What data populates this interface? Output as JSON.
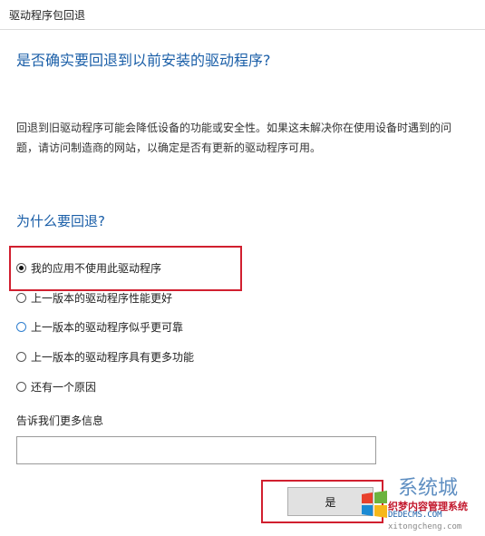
{
  "window": {
    "title": "驱动程序包回退"
  },
  "main_heading": "是否确实要回退到以前安装的驱动程序?",
  "description": "回退到旧驱动程序可能会降低设备的功能或安全性。如果这未解决你在使用设备时遇到的问题，请访问制造商的网站，以确定是否有更新的驱动程序可用。",
  "reasons": {
    "heading": "为什么要回退?",
    "options": [
      {
        "label": "我的应用不使用此驱动程序",
        "selected": true
      },
      {
        "label": "上一版本的驱动程序性能更好",
        "selected": false
      },
      {
        "label": "上一版本的驱动程序似乎更可靠",
        "selected": false
      },
      {
        "label": "上一版本的驱动程序具有更多功能",
        "selected": false
      },
      {
        "label": "还有一个原因",
        "selected": false
      }
    ]
  },
  "more_info": {
    "label": "告诉我们更多信息",
    "value": ""
  },
  "buttons": {
    "yes_label": "是"
  },
  "watermark": {
    "line1": "织梦内容管理系统",
    "line2": "DEDECMS.COM",
    "line3": "xitongcheng.com"
  },
  "colors": {
    "heading": "#1b5fa8",
    "highlight": "#d11f2f"
  }
}
